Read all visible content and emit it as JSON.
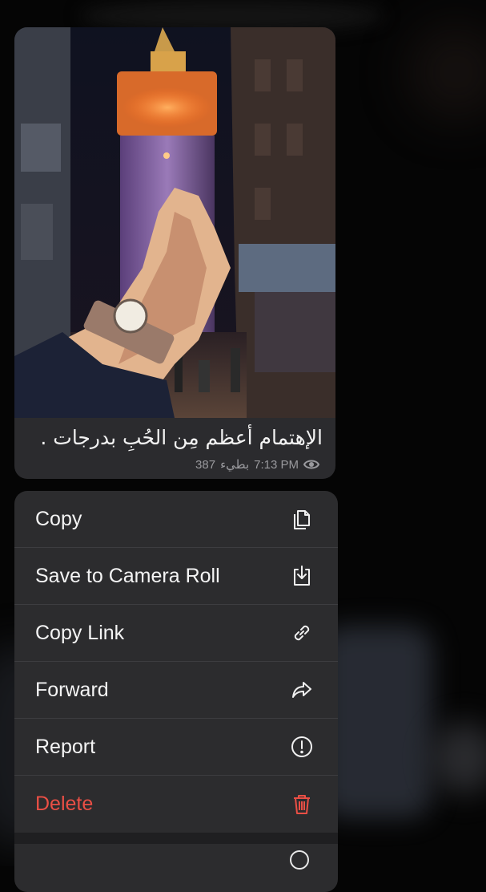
{
  "message": {
    "caption": "الإهتمام أعظم مِن الحُبِ بدرجات .",
    "views": "387",
    "edited_label": "بطيء",
    "time": "7:13 PM"
  },
  "menu": {
    "items": [
      {
        "label": "Copy",
        "icon": "copy-icon"
      },
      {
        "label": "Save to Camera Roll",
        "icon": "save-icon"
      },
      {
        "label": "Copy Link",
        "icon": "link-icon"
      },
      {
        "label": "Forward",
        "icon": "forward-icon"
      },
      {
        "label": "Report",
        "icon": "report-icon"
      },
      {
        "label": "Delete",
        "icon": "trash-icon"
      }
    ]
  },
  "colors": {
    "menu_bg": "#2c2c2e",
    "danger": "#ea4f45",
    "text": "#f4f4f4",
    "meta": "#9a9a9e"
  }
}
